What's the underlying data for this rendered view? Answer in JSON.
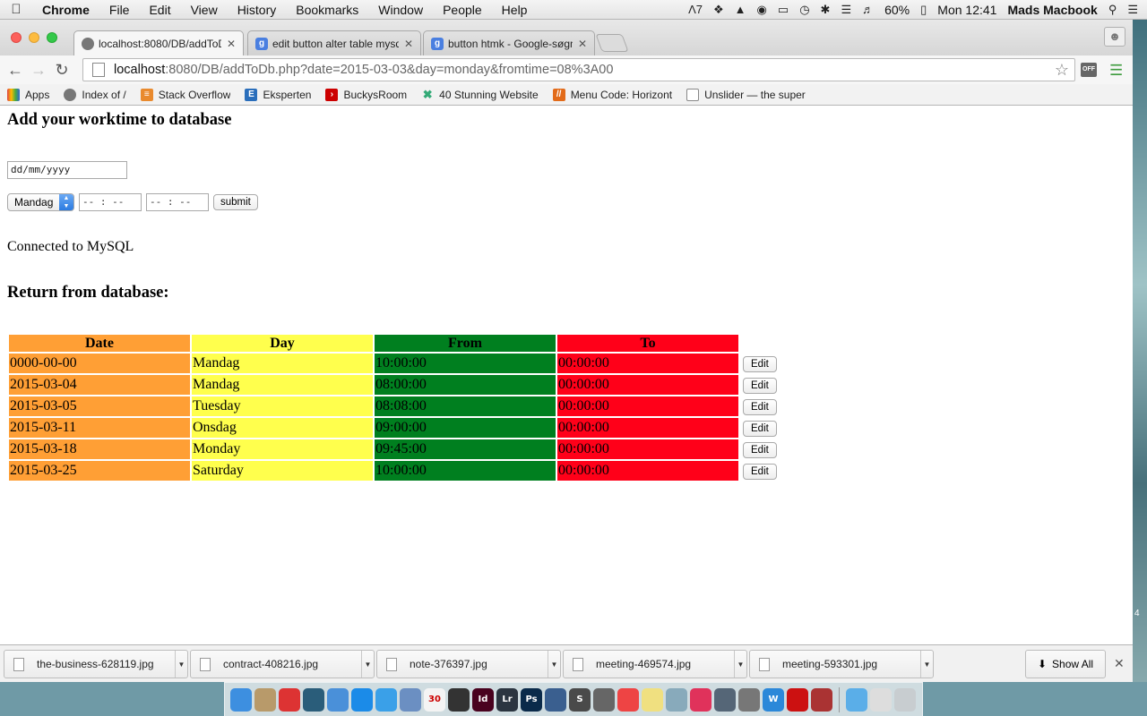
{
  "menubar": {
    "app_name": "Chrome",
    "menus": [
      "File",
      "Edit",
      "View",
      "History",
      "Bookmarks",
      "Window",
      "People",
      "Help"
    ],
    "status_extra": "7",
    "battery": "60%",
    "clock": "Mon 12:41",
    "user": "Mads Macbook"
  },
  "tabs": [
    {
      "label": "localhost:8080/DB/addToD",
      "favicon": "page-icon",
      "active": true
    },
    {
      "label": "edit button alter table mysq",
      "favicon": "google-icon",
      "active": false
    },
    {
      "label": "button htmk - Google-søgni",
      "favicon": "google-icon",
      "active": false
    }
  ],
  "omnibox": {
    "host": "localhost",
    "rest": ":8080/DB/addToDb.php?date=2015-03-03&day=monday&fromtime=08%3A00"
  },
  "extension_badge": "OFF",
  "bookmarks": [
    {
      "label": "Apps",
      "icon": "apps-grid-icon",
      "color": "#d44"
    },
    {
      "label": "Index of /",
      "icon": "page-icon",
      "color": "#666"
    },
    {
      "label": "Stack Overflow",
      "icon": "stackoverflow-icon",
      "color": "#e98a2e"
    },
    {
      "label": "Eksperten",
      "icon": "eksperten-icon",
      "color": "#2a6ebb"
    },
    {
      "label": "BuckysRoom",
      "icon": "buckysroom-icon",
      "color": "#c00"
    },
    {
      "label": "40 Stunning Website",
      "icon": "cross-icon",
      "color": "#3a7"
    },
    {
      "label": "Menu Code: Horizont",
      "icon": "menu-code-icon",
      "color": "#e26b1a"
    },
    {
      "label": "Unslider — the super",
      "icon": "page-icon",
      "color": "#888"
    }
  ],
  "page": {
    "title": "Add your worktime to database",
    "date_placeholder": "dd/mm/yyyy",
    "day_select_value": "Mandag",
    "from_time_placeholder": "-- : --",
    "to_time_placeholder": "-- : --",
    "submit_label": "submit",
    "status": "Connected to MySQL",
    "return_title": "Return from database:"
  },
  "table": {
    "headers": [
      "Date",
      "Day",
      "From",
      "To"
    ],
    "edit_label": "Edit",
    "rows": [
      {
        "date": "0000-00-00",
        "day": "Mandag",
        "from": "10:00:00",
        "to": "00:00:00"
      },
      {
        "date": "2015-03-04",
        "day": "Mandag",
        "from": "08:00:00",
        "to": "00:00:00"
      },
      {
        "date": "2015-03-05",
        "day": "Tuesday",
        "from": "08:08:00",
        "to": "00:00:00"
      },
      {
        "date": "2015-03-11",
        "day": "Onsdag",
        "from": "09:00:00",
        "to": "00:00:00"
      },
      {
        "date": "2015-03-18",
        "day": "Monday",
        "from": "09:45:00",
        "to": "00:00:00"
      },
      {
        "date": "2015-03-25",
        "day": "Saturday",
        "from": "10:00:00",
        "to": "00:00:00"
      }
    ],
    "colors": {
      "date": "#ff9f35",
      "day": "#ffff4d",
      "from": "#007f1f",
      "to": "#ff0019"
    }
  },
  "downloads": {
    "items": [
      "the-business-628119.jpg",
      "contract-408216.jpg",
      "note-376397.jpg",
      "meeting-469574.jpg",
      "meeting-593301.jpg"
    ],
    "show_all": "Show All"
  },
  "dock": {
    "calendar_day": "30",
    "apps": [
      {
        "name": "finder-icon",
        "label": "",
        "color": "#3d8fe0"
      },
      {
        "name": "pencil-icon",
        "label": "",
        "color": "#b89a6a"
      },
      {
        "name": "scrapbook-icon",
        "label": "",
        "color": "#d33"
      },
      {
        "name": "time-machine-icon",
        "label": "",
        "color": "#2a5d7a"
      },
      {
        "name": "xcode-icon",
        "label": "",
        "color": "#4a90d9"
      },
      {
        "name": "app-store-icon",
        "label": "",
        "color": "#1b8be8"
      },
      {
        "name": "safari-icon",
        "label": "",
        "color": "#3aa0e8"
      },
      {
        "name": "preview-icon",
        "label": "",
        "color": "#6b8fc2"
      },
      {
        "name": "calendar-icon",
        "label": "30",
        "color": "#f4f4f4"
      },
      {
        "name": "dvd-player-icon",
        "label": "",
        "color": "#333"
      },
      {
        "name": "indesign-icon",
        "label": "Id",
        "color": "#49021f"
      },
      {
        "name": "lightroom-icon",
        "label": "Lr",
        "color": "#2b3540"
      },
      {
        "name": "photoshop-icon",
        "label": "Ps",
        "color": "#0a2a4a"
      },
      {
        "name": "instruments-icon",
        "label": "",
        "color": "#3a5f8f"
      },
      {
        "name": "sublime-icon",
        "label": "S",
        "color": "#4a4a4a"
      },
      {
        "name": "github-icon",
        "label": "",
        "color": "#666"
      },
      {
        "name": "chrome-icon",
        "label": "",
        "color": "#e44"
      },
      {
        "name": "notes-icon",
        "label": "",
        "color": "#f0e080"
      },
      {
        "name": "photos-icon",
        "label": "",
        "color": "#8ab"
      },
      {
        "name": "itunes-icon",
        "label": "",
        "color": "#e0325b"
      },
      {
        "name": "utility-icon",
        "label": "",
        "color": "#567"
      },
      {
        "name": "system-prefs-icon",
        "label": "",
        "color": "#777"
      },
      {
        "name": "wunderlist-icon",
        "label": "W",
        "color": "#2b88d9"
      },
      {
        "name": "acrobat-icon",
        "label": "",
        "color": "#c11"
      },
      {
        "name": "photo-booth-icon",
        "label": "",
        "color": "#a33"
      }
    ],
    "trailing": [
      {
        "name": "applications-folder-icon",
        "label": "",
        "color": "#5aaee8"
      },
      {
        "name": "documents-icon",
        "label": "",
        "color": "#ddd"
      },
      {
        "name": "trash-icon",
        "label": "",
        "color": "#c8cdd0"
      }
    ]
  },
  "side_number": "4"
}
